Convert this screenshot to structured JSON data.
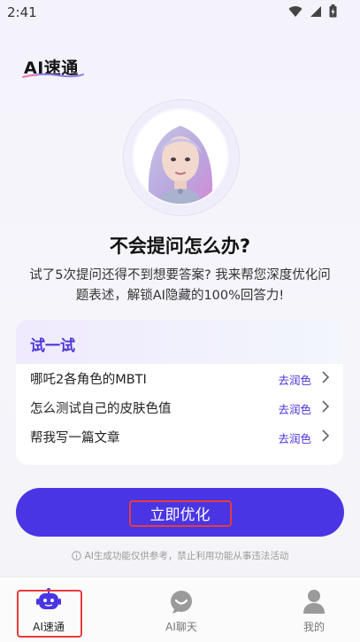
{
  "status_bar": {
    "time": "2:41"
  },
  "header": {
    "brand": "AI速通"
  },
  "hero": {
    "headline": "不会提问怎么办?",
    "description": "试了5次提问还得不到想要答案? 我来帮您深度优化问题表述，解锁AI隐藏的100%回答力!"
  },
  "try_card": {
    "title": "试一试",
    "items": [
      {
        "text": "哪吒2各角色的MBTI",
        "action": "去润色"
      },
      {
        "text": "怎么测试自己的皮肤色值",
        "action": "去润色"
      },
      {
        "text": "帮我写一篇文章",
        "action": "去润色"
      }
    ]
  },
  "cta": {
    "label": "立即优化"
  },
  "disclaimer": "AI生成功能仅供参考，禁止利用功能从事违法活动",
  "tabs": [
    {
      "label": "AI速通",
      "icon": "robot-icon",
      "active": true
    },
    {
      "label": "AI聊天",
      "icon": "chat-bubble-icon",
      "active": false
    },
    {
      "label": "我的",
      "icon": "user-icon",
      "active": false
    }
  ],
  "colors": {
    "accent": "#4a35e4",
    "highlight_box": "#e63c3c"
  }
}
